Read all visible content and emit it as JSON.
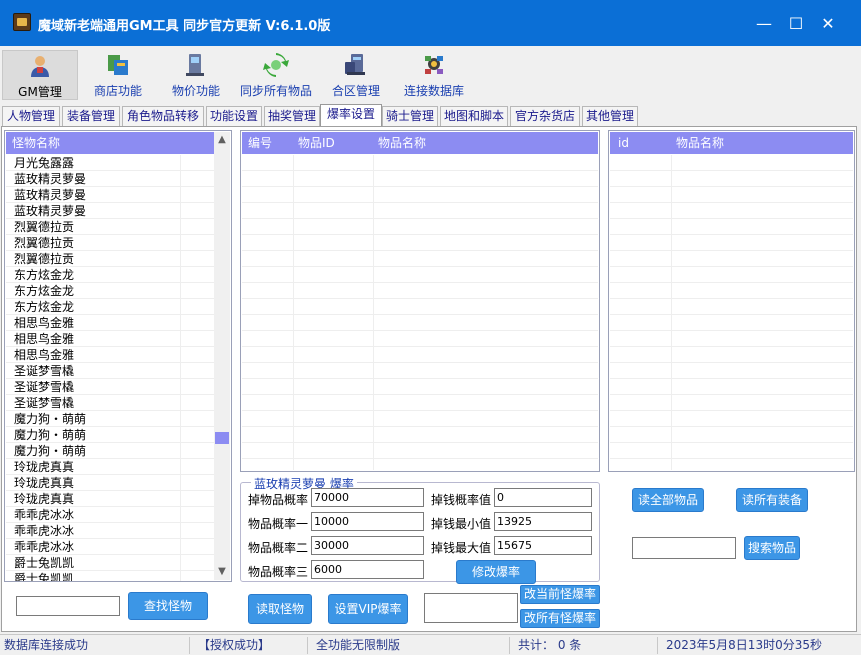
{
  "window": {
    "title": "魔域新老端通用GM工具 同步官方更新 V:6.1.0版",
    "controls": {
      "minimize": "—",
      "maximize": "☐",
      "close": "✕"
    }
  },
  "toolbar": [
    {
      "label": "GM管理",
      "icon": "user-icon"
    },
    {
      "label": "商店功能",
      "icon": "shop-icon"
    },
    {
      "label": "物价功能",
      "icon": "computer-icon"
    },
    {
      "label": "同步所有物品",
      "icon": "refresh-icon"
    },
    {
      "label": "合区管理",
      "icon": "server-icon"
    },
    {
      "label": "连接数据库",
      "icon": "network-icon"
    }
  ],
  "tabs": [
    "人物管理",
    "装备管理",
    "角色物品转移",
    "功能设置",
    "抽奖管理",
    "爆率设置",
    "骑士管理",
    "地图和脚本",
    "官方杂货店",
    "其他管理"
  ],
  "monster_list": {
    "header": "怪物名称",
    "rows": [
      "月光兔露露",
      "蓝玫精灵萝曼",
      "蓝玫精灵萝曼",
      "蓝玫精灵萝曼",
      "烈翼德拉贡",
      "烈翼德拉贡",
      "烈翼德拉贡",
      "东方炫金龙",
      "东方炫金龙",
      "东方炫金龙",
      "相思鸟金雅",
      "相思鸟金雅",
      "相思鸟金雅",
      "圣诞梦雪橇",
      "圣诞梦雪橇",
      "圣诞梦雪橇",
      "魔力狗・萌萌",
      "魔力狗・萌萌",
      "魔力狗・萌萌",
      "玲珑虎真真",
      "玲珑虎真真",
      "玲珑虎真真",
      "乖乖虎冰冰",
      "乖乖虎冰冰",
      "乖乖虎冰冰",
      "爵士兔凯凯",
      "爵士兔凯凯"
    ]
  },
  "drop_table": {
    "headers": [
      "编号",
      "物品ID",
      "物品名称"
    ]
  },
  "item_table": {
    "headers": [
      "id",
      "物品名称"
    ]
  },
  "rate_group": {
    "title": "蓝玫精灵萝曼 爆率",
    "fields": [
      {
        "label": "掉物品概率",
        "value": "70000"
      },
      {
        "label": "物品概率一",
        "value": "10000"
      },
      {
        "label": "物品概率二",
        "value": "30000"
      },
      {
        "label": "物品概率三",
        "value": "6000"
      },
      {
        "label": "掉钱概率值",
        "value": "0"
      },
      {
        "label": "掉钱最小值",
        "value": "13925"
      },
      {
        "label": "掉钱最大值",
        "value": "15675"
      }
    ],
    "modify_button": "修改爆率"
  },
  "buttons": {
    "find_monster": "查找怪物",
    "read_monster": "读取怪物",
    "set_vip": "设置VIP爆率",
    "change_current": "改当前怪爆率",
    "change_all": "改所有怪爆率",
    "read_all_items": "读全部物品",
    "read_all_equip": "读所有装备",
    "search_item": "搜索物品"
  },
  "inputs": {
    "monster_search": "",
    "vip_rate": "",
    "item_search": ""
  },
  "status": {
    "db": "数据库连接成功",
    "auth": "【授权成功】",
    "edition": "全功能无限制版",
    "count": "共计：  0 条",
    "datetime": "2023年5月8日13时0分35秒"
  },
  "colors": {
    "titlebar": "#0b6fd6",
    "header": "#8c8cf2",
    "button": "#3c96e6"
  }
}
